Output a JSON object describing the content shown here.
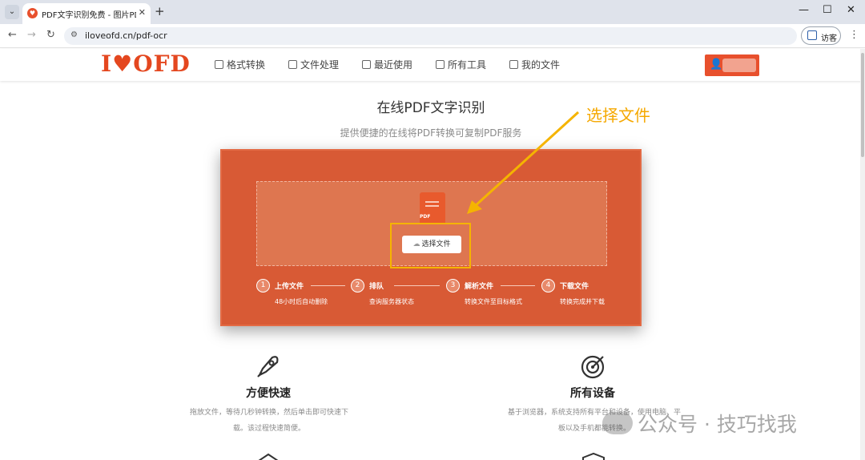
{
  "browser": {
    "tab_title": "PDF文字识别免费 - 图片PDF转",
    "new_tab_label": "+",
    "close_tab_label": "✕",
    "url": "iloveofd.cn/pdf-ocr",
    "guest_label": "访客",
    "window_controls": {
      "minimize": "—",
      "maximize": "☐",
      "close": "✕"
    },
    "icons": [
      "back-icon",
      "forward-icon",
      "reload-icon",
      "site-info-icon",
      "profile-icon",
      "menu-icon"
    ]
  },
  "header": {
    "logo_text": "I♥OFD",
    "brand_color": "#e4471f",
    "menu": [
      {
        "label": "格式转换",
        "icon": "format-convert-icon"
      },
      {
        "label": "文件处理",
        "icon": "file-process-icon"
      },
      {
        "label": "最近使用",
        "icon": "recent-icon"
      },
      {
        "label": "所有工具",
        "icon": "all-tools-icon"
      },
      {
        "label": "我的文件",
        "icon": "my-files-icon"
      }
    ]
  },
  "main": {
    "title": "在线PDF文字识别",
    "subtitle": "提供便捷的在线将PDF转换可复制PDF服务",
    "panel_color": "#d85a35",
    "file_icon_tag": "PDF",
    "choose_button_label": "选择文件",
    "steps": [
      {
        "num": "1",
        "name": "上传文件",
        "desc": "48小时后自动删除"
      },
      {
        "num": "2",
        "name": "排队",
        "desc": "查询服务器状态"
      },
      {
        "num": "3",
        "name": "解析文件",
        "desc": "转换文件至目标格式"
      },
      {
        "num": "4",
        "name": "下载文件",
        "desc": "转换完成并下载"
      }
    ]
  },
  "annotation": {
    "text": "选择文件",
    "color": "#f5b400"
  },
  "features": [
    {
      "title": "方便快速",
      "desc_line1": "拖放文件，等待几秒钟转换，然后单击即可快速下",
      "desc_line2": "载。该过程快速简便。",
      "icon": "rocket-icon"
    },
    {
      "title": "所有设备",
      "desc_line1": "基于浏览器，系统支持所有平台和设备，使用电脑、平",
      "desc_line2": "板以及手机都能转换。",
      "icon": "target-icon"
    }
  ],
  "watermark": "公众号 · 技巧找我"
}
